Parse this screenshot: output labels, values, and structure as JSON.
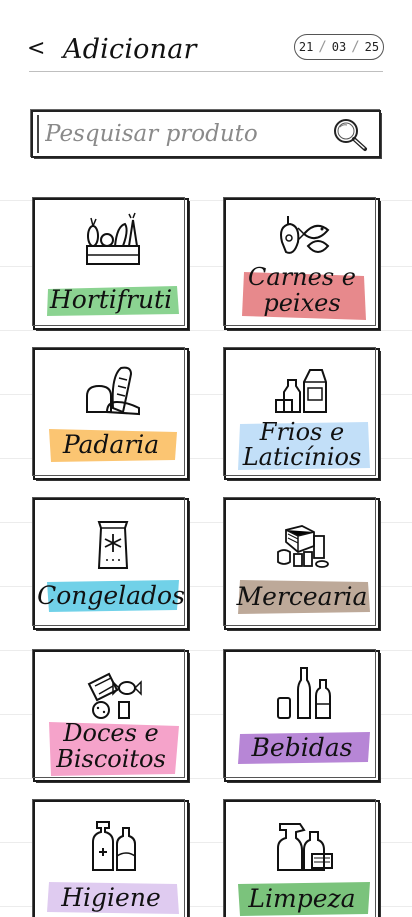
{
  "header": {
    "back_label": "<",
    "title": "Adicionar",
    "date": {
      "day": "21",
      "month": "03",
      "year": "25"
    }
  },
  "search": {
    "placeholder": "Pesquisar produto",
    "icon": "search-icon"
  },
  "categories": [
    {
      "label": "Hortifruti",
      "icon": "produce-icon",
      "highlight": "#7fcf86"
    },
    {
      "label_line1": "Carnes e",
      "label_line2": "peixes",
      "icon": "meat-fish-icon",
      "highlight": "#e57d80"
    },
    {
      "label": "Padaria",
      "icon": "bread-icon",
      "highlight": "#fbbf63"
    },
    {
      "label_line1": "Frios e",
      "label_line2": "Laticínios",
      "icon": "dairy-icon",
      "highlight": "#bcdcf8"
    },
    {
      "label": "Congelados",
      "icon": "frozen-icon",
      "highlight": "#62cde6"
    },
    {
      "label": "Mercearia",
      "icon": "grocery-icon",
      "highlight": "#b6a08f"
    },
    {
      "label_line1": "Doces e",
      "label_line2": "Biscoitos",
      "icon": "candy-icon",
      "highlight": "#f49ac5"
    },
    {
      "label": "Bebidas",
      "icon": "drinks-icon",
      "highlight": "#b07ad2"
    },
    {
      "label": "Higiene",
      "icon": "hygiene-icon",
      "highlight": "#dcc6ef"
    },
    {
      "label": "Limpeza",
      "icon": "cleaning-icon",
      "highlight": "#6dbd6e"
    }
  ]
}
